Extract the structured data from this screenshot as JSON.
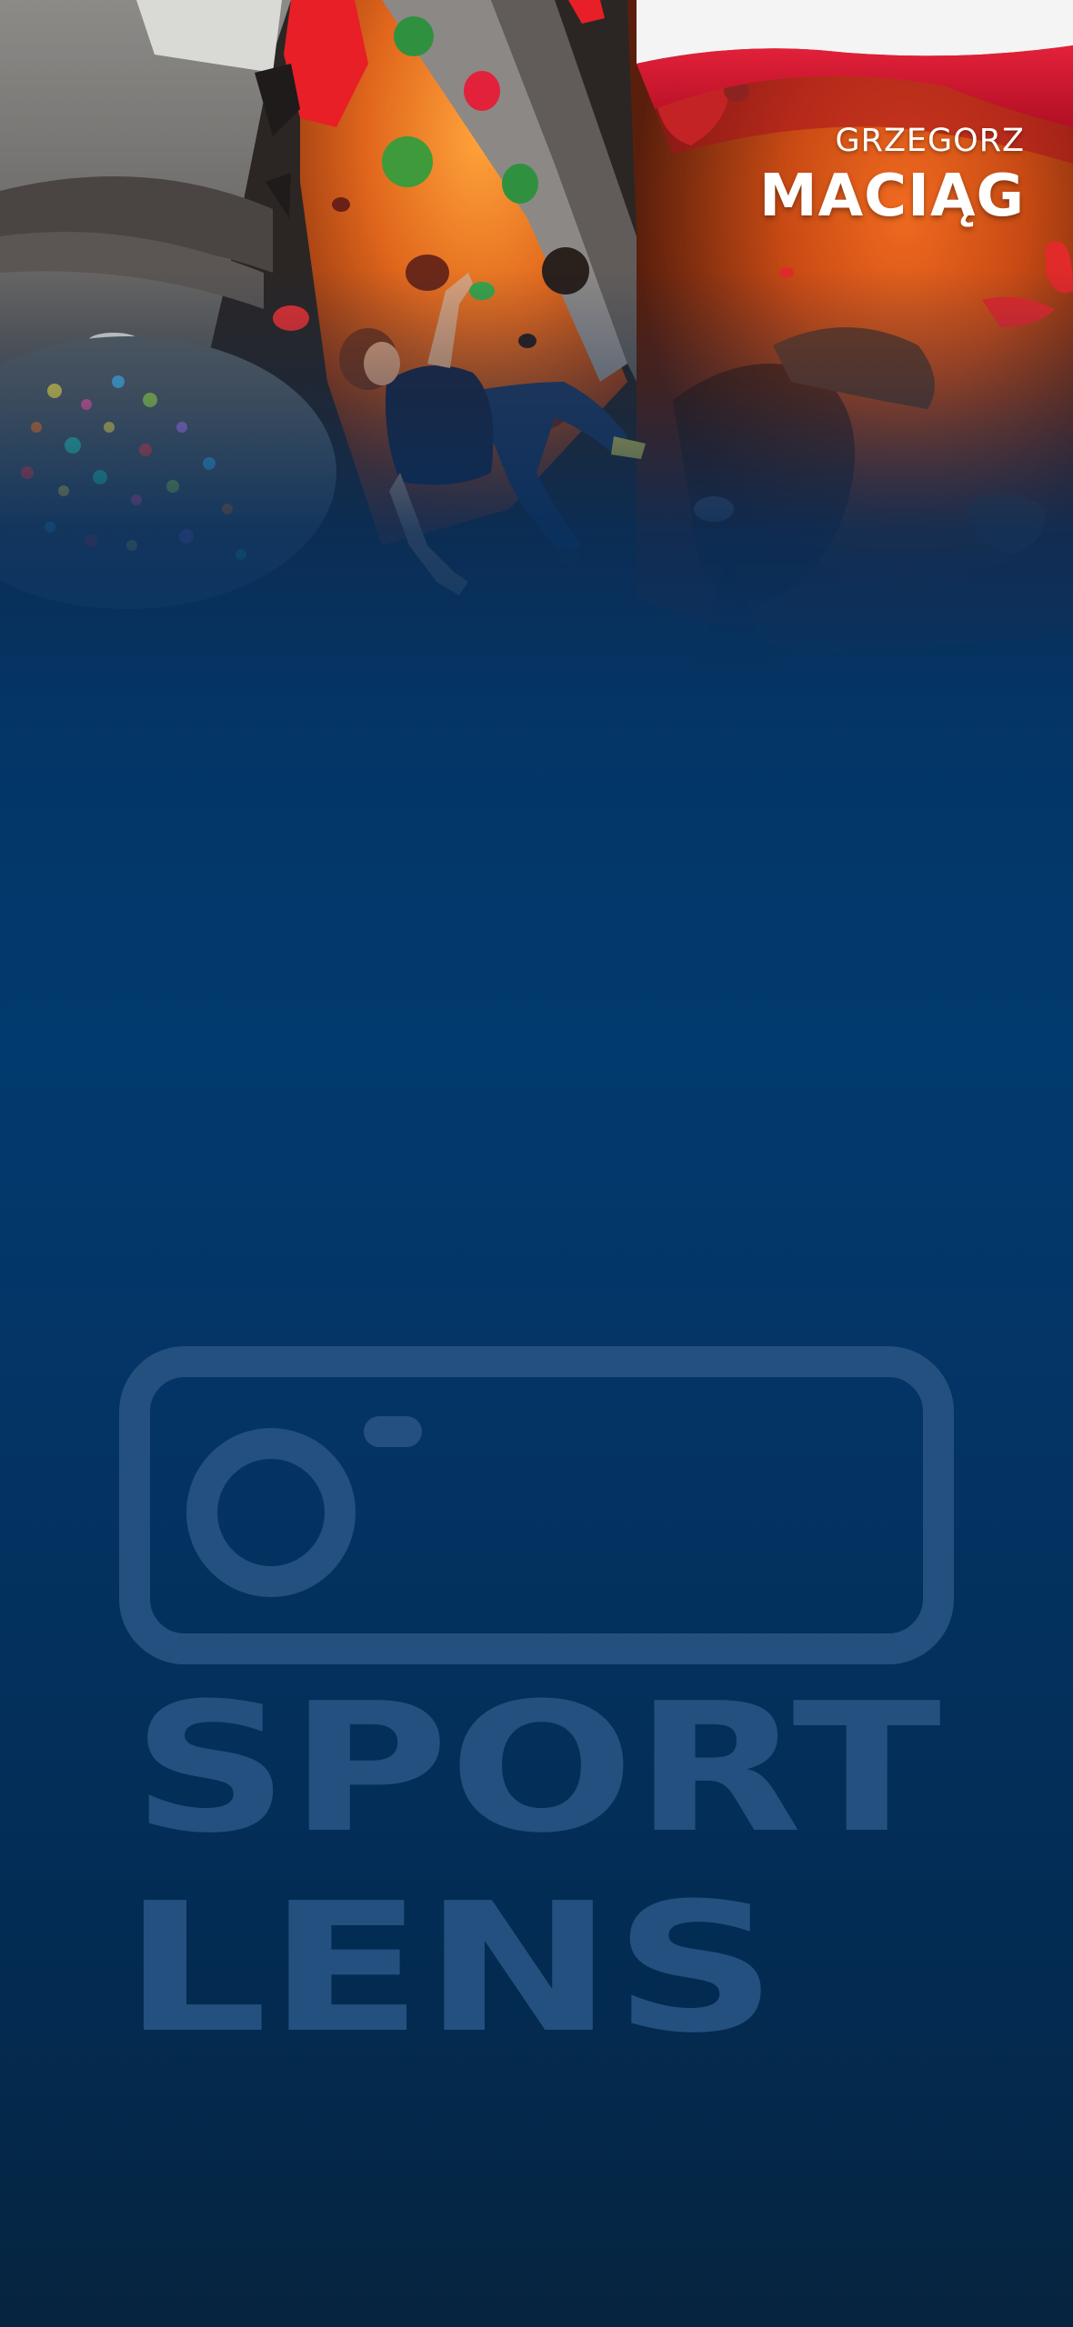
{
  "athlete": {
    "first_name": "GRZEGORZ",
    "last_name": "MACIĄG"
  },
  "logo": {
    "line1": "SPORT",
    "line2": "LENS"
  },
  "colors": {
    "background_top": "#0a2a52",
    "background_mid": "#013a6e",
    "background_bottom": "#06243f",
    "watermark": "#24507f",
    "flag_white": "#f4f4f4",
    "flag_red": "#d7142b",
    "climbing_wall": "#d4521a"
  },
  "icons": {
    "logo_mark": "camera-icon",
    "flag": "poland-flag"
  }
}
